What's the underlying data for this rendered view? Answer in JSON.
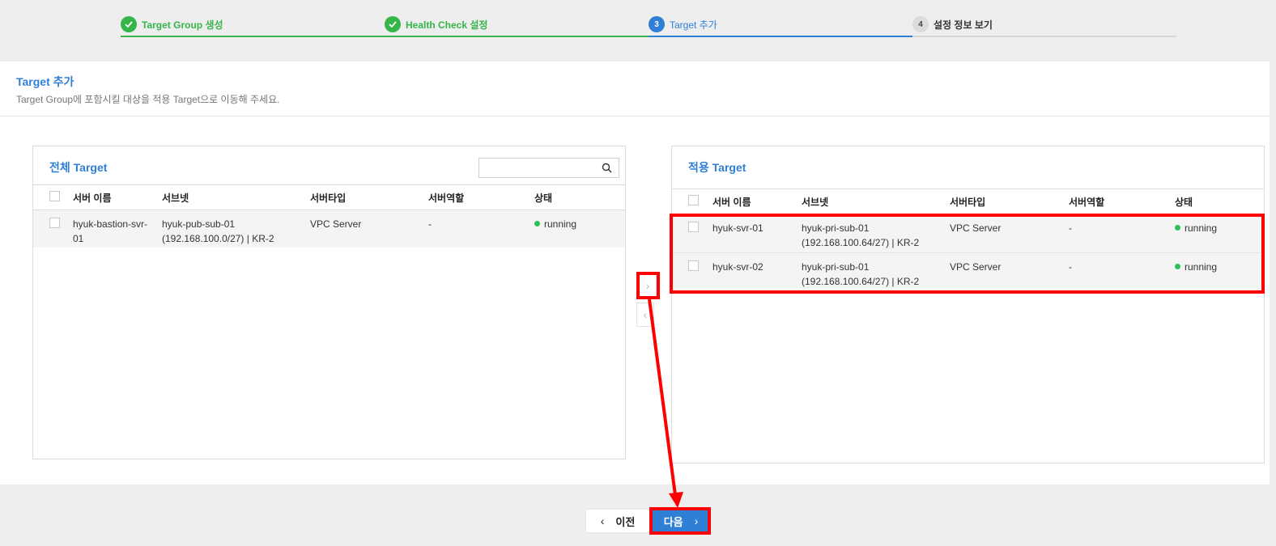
{
  "stepper": {
    "steps": [
      {
        "badge": "",
        "label": "Target Group 생성",
        "state": "done"
      },
      {
        "badge": "",
        "label": "Health Check 설정",
        "state": "done"
      },
      {
        "badge": "3",
        "label": "Target 추가",
        "state": "active"
      },
      {
        "badge": "4",
        "label": "설정 정보 보기",
        "state": "todo"
      }
    ]
  },
  "header": {
    "title": "Target 추가",
    "description": "Target Group에 포함시킬 대상을 적용 Target으로 이동해 주세요."
  },
  "all_targets": {
    "title_prefix": "전체",
    "title_suffix": " Target",
    "search_placeholder": "",
    "columns": [
      "서버 이름",
      "서브넷",
      "서버타입",
      "서버역할",
      "상태"
    ],
    "rows": [
      {
        "name": "hyuk-bastion-svr-01",
        "subnet": "hyuk-pub-sub-01 (192.168.100.0/27) | KR-2",
        "server_type": "VPC Server",
        "role": "-",
        "status": "running"
      }
    ]
  },
  "applied_targets": {
    "title_prefix": "적용",
    "title_suffix": " Target",
    "columns": [
      "서버 이름",
      "서브넷",
      "서버타입",
      "서버역할",
      "상태"
    ],
    "rows": [
      {
        "name": "hyuk-svr-01",
        "subnet": "hyuk-pri-sub-01 (192.168.100.64/27) | KR-2",
        "server_type": "VPC Server",
        "role": "-",
        "status": "running"
      },
      {
        "name": "hyuk-svr-02",
        "subnet": "hyuk-pri-sub-01 (192.168.100.64/27) | KR-2",
        "server_type": "VPC Server",
        "role": "-",
        "status": "running"
      }
    ]
  },
  "footer": {
    "prev_label": "이전",
    "next_label": "다음"
  },
  "colors": {
    "accent": "#2f7fd6",
    "done": "#35b54a",
    "running": "#2bc15a",
    "annotation": "#ff0000"
  }
}
